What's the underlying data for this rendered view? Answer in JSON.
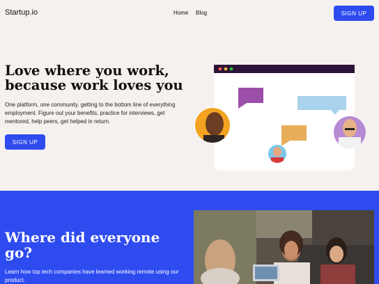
{
  "header": {
    "logo": "Startup.io",
    "nav": [
      {
        "label": "Home"
      },
      {
        "label": "Blog"
      }
    ],
    "signup_label": "SIGN UP"
  },
  "hero": {
    "title": "Love where you work, because work loves you",
    "description": "One platform, one community, getting to the bottom line of everything employment. Figure out your benefits, practice for interviews, get mentored, help peers, get helped in return.",
    "signup_label": "SIGN UP"
  },
  "section2": {
    "title": "Where did everyone go?",
    "description": "Learn how top tech companies have learned working remote using our product."
  },
  "colors": {
    "accent": "#2e4bf0",
    "background": "#f5f1ee",
    "window_bar": "#2c1438"
  },
  "icons": [
    "window-dots-icon",
    "chat-bubble-icon",
    "avatar"
  ]
}
